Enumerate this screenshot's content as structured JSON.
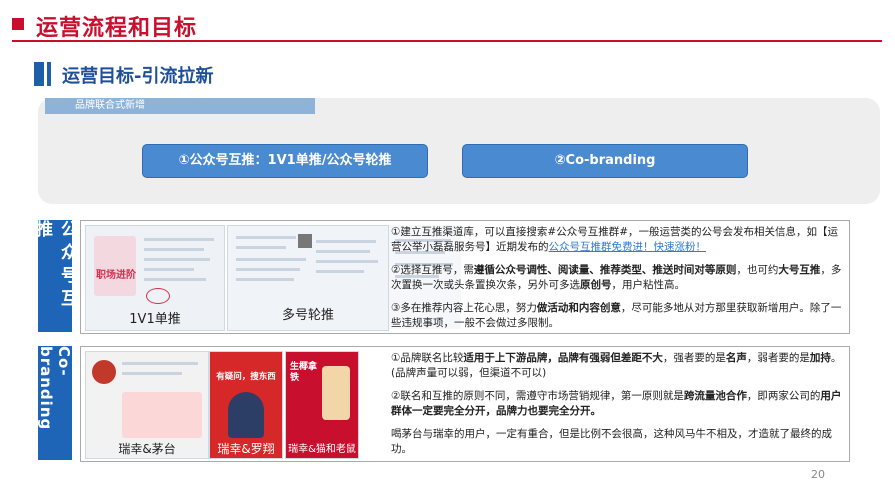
{
  "header": {
    "title": "运营流程和目标",
    "subtitle": "运营目标-引流拉新"
  },
  "top_panel": {
    "tab_label": "品牌联合式新增",
    "buttons": [
      "①公众号互推：1V1单推/公众号轮推",
      "②Co-branding"
    ]
  },
  "section1": {
    "side_label": "公众号互推",
    "images": [
      {
        "caption": "1V1单推",
        "overlay": "职场进阶"
      },
      {
        "caption": "多号轮推"
      }
    ],
    "paragraphs": [
      {
        "p1": "①建立互推渠道库，可以直接搜索#公众号互推群#，一般运营类的公号会发布相关信息，如【运营公举小磊磊服务号】近期发布的",
        "link": "公众号互推群免费进！快速涨粉！"
      },
      {
        "a": "②选择互推号，需",
        "b1": "遵循公众号调性、阅读量、推荐类型、推送时间对等原则",
        "c": "，也可约",
        "b2": "大号互推",
        "d": "，多次置换一次或头条置换次条，另外可多选",
        "b3": "原创号",
        "e": "，用户粘性高。"
      },
      {
        "a": "③多在推荐内容上花心思，努力",
        "b1": "做活动和内容创意",
        "c": "，尽可能多地从对方那里获取新增用户。除了一些违规事项，一般不会做过多限制。"
      }
    ]
  },
  "section2": {
    "side_label": "Co-branding",
    "images": [
      {
        "caption": "瑞幸&茅台"
      },
      {
        "caption": "瑞幸&罗翔",
        "overlay": "有疑问，搜东西"
      },
      {
        "caption": "瑞幸&猫和老鼠",
        "overlay": "生椰拿铁"
      }
    ],
    "paragraphs": [
      {
        "a": "①品牌联名比较",
        "b1": "适用于上下游品牌，品牌有强弱但差距不大",
        "c": "，强者要的是",
        "b2": "名声",
        "d": "，弱者要的是",
        "b3": "加持",
        "e": "。(品牌声量可以弱，但渠道不可以)"
      },
      {
        "a": "②联名和互推的原则不同，需遵守市场营销规律，第一原则就是",
        "b1": "跨流量池合作",
        "c": "，即两家公司的",
        "b2": "用户群体一定要完全分开，品牌力也要完全分开。"
      },
      {
        "a": "喝茅台与瑞幸的用户，一定有重合，但是比例不会很高，这种风马牛不相及，才造就了最终的成功。"
      }
    ]
  },
  "footer": {
    "page_number": "20"
  },
  "colors": {
    "accent_red": "#c8102e",
    "primary_blue": "#1f65b7",
    "button_blue": "#4a8ad0",
    "link_blue": "#2f7bd6"
  }
}
